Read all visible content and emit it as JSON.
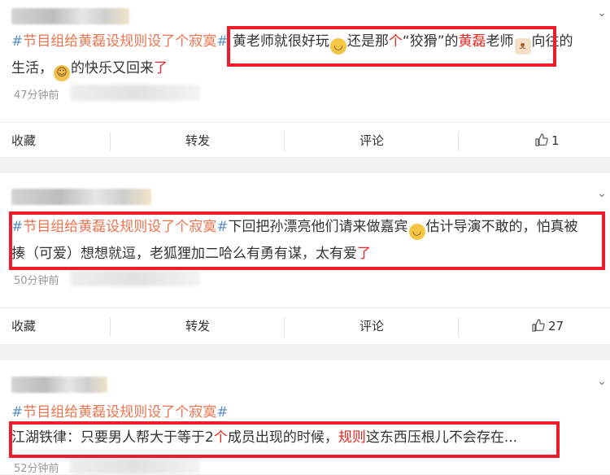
{
  "posts": [
    {
      "line1": {
        "hashtag": "节目组给黄磊设规则设了个寂寞",
        "hash": "#",
        "t1": "黄老师就很好玩",
        "t2": "还是那",
        "red1": "个",
        "t3": "“狡猾”的",
        "red2": "黄磊",
        "t4": "老师",
        "t5": "向往的"
      },
      "line2": {
        "t1": "生活，",
        "t2": "的快乐又回来",
        "red": "了"
      },
      "time": "47分钟前",
      "actions": {
        "collect": "收藏",
        "repost": "转发",
        "comment": "评论",
        "likes": "1"
      }
    },
    {
      "line1": {
        "hashtag": "节目组给黄磊设规则设了个寂寞",
        "hash": "#",
        "t1": "下回把孙漂亮他们请来做嘉宾",
        "t2": "估计导演不敢的，怕真被"
      },
      "line2": {
        "t1": "揍（可爱）想想就逗，老狐狸加二哈么有勇有谋，太有爱",
        "red": "了"
      },
      "time": "50分钟前",
      "actions": {
        "collect": "收藏",
        "repost": "转发",
        "comment": "评论",
        "likes": "27"
      }
    },
    {
      "line1": {
        "hashtag": "节目组给黄磊设规则设了个寂寞",
        "hash": "#"
      },
      "line2": {
        "t1": "江湖铁律：只要男人帮大于等于2",
        "red1": "个",
        "t2": "成员出现的时候，",
        "red2": "规则",
        "t3": "这东西压根儿不会存在..."
      },
      "time": "52分钟前"
    }
  ],
  "icons": {
    "emoji1": "laughing-cry-emoji",
    "emoji2": "cat-emoji",
    "emoji3": "smile-emoji",
    "thumb": "thumb-up-icon",
    "chevron": "chevron-down-icon"
  }
}
